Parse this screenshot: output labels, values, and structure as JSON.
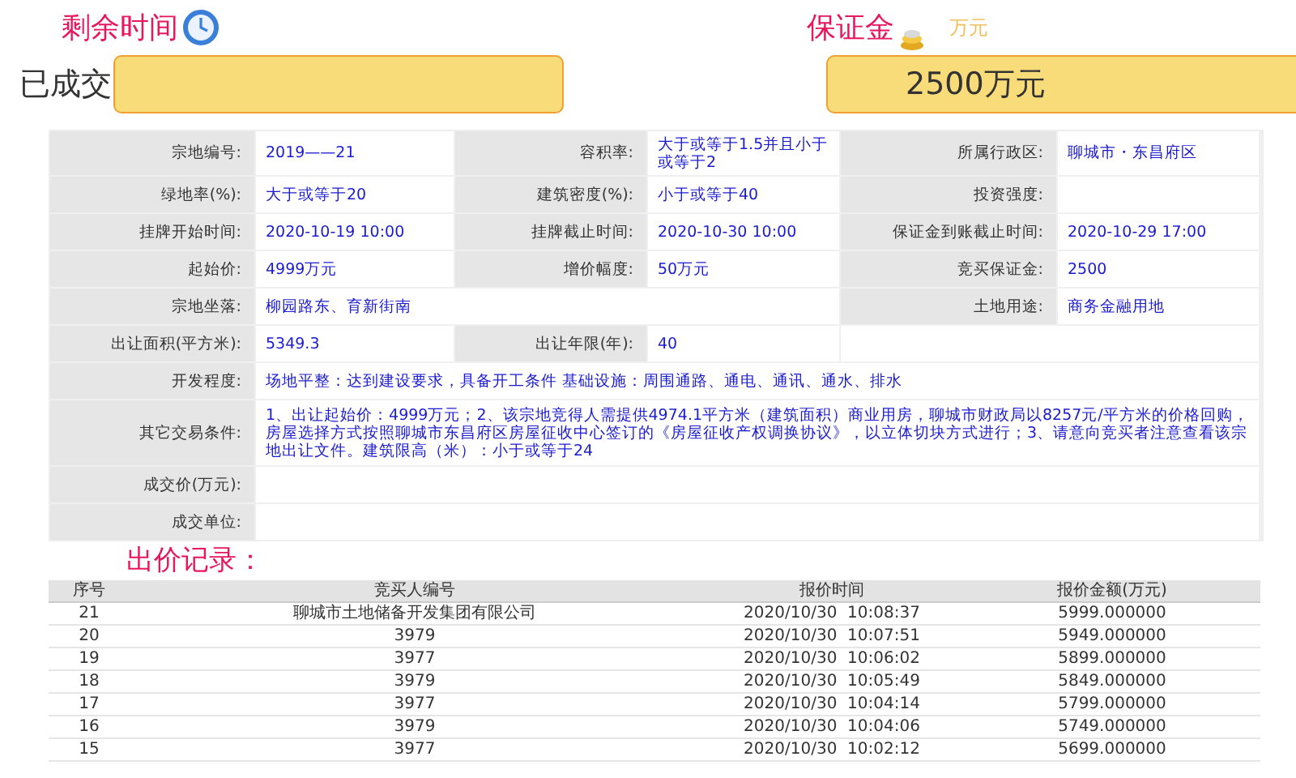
{
  "header": {
    "timer_label": "剩余时间",
    "status": "已成交",
    "deposit_label": "保证金",
    "deposit_unit": "万元",
    "deposit_value": "2500万元"
  },
  "info_rows": [
    {
      "fields": [
        {
          "kind": "pair",
          "label": "宗地编号:",
          "value": "2019——21"
        },
        {
          "kind": "pair",
          "label": "容积率:",
          "value": "大于或等于1.5并且小于或等于2"
        },
        {
          "kind": "pair",
          "label": "所属行政区:",
          "value": "聊城市・东昌府区"
        }
      ]
    },
    {
      "fields": [
        {
          "kind": "pair",
          "label": "绿地率(%):",
          "value": "大于或等于20"
        },
        {
          "kind": "pair",
          "label": "建筑密度(%):",
          "value": "小于或等于40"
        },
        {
          "kind": "pair",
          "label": "投资强度:"
        }
      ]
    },
    {
      "fields": [
        {
          "kind": "pair",
          "label": "挂牌开始时间:",
          "value": "2020-10-19 10:00"
        },
        {
          "kind": "pair",
          "label": "挂牌截止时间:",
          "value": "2020-10-30 10:00"
        },
        {
          "kind": "pair",
          "label": "保证金到账截止时间:",
          "value": "2020-10-29 17:00"
        }
      ]
    },
    {
      "fields": [
        {
          "kind": "pair",
          "label": "起始价:",
          "value": "4999万元"
        },
        {
          "kind": "pair",
          "label": "增价幅度:",
          "value": "50万元"
        },
        {
          "kind": "pair",
          "label": "竞买保证金:",
          "value": "2500"
        }
      ]
    },
    {
      "fields": [
        {
          "kind": "wide",
          "label": "宗地坐落:",
          "value": "柳园路东、育新街南"
        },
        {
          "kind": "pair",
          "label": "土地用途:",
          "value": "商务金融用地"
        }
      ]
    },
    {
      "fields": [
        {
          "kind": "pair",
          "label": "出让面积(平方米):",
          "value": "5349.3"
        },
        {
          "kind": "pair",
          "label": "出让年限(年):",
          "value": "40"
        }
      ]
    },
    {
      "fields": [
        {
          "kind": "full",
          "label": "开发程度:",
          "value": "场地平整：达到建设要求，具备开工条件 基础设施：周围通路、通电、通讯、通水、排水"
        }
      ]
    },
    {
      "fields": [
        {
          "kind": "full",
          "label": "其它交易条件:",
          "value": "1、出让起始价：4999万元；2、该宗地竞得人需提供4974.1平方米（建筑面积）商业用房，聊城市财政局以8257元/平方米的价格回购，房屋选择方式按照聊城市东昌府区房屋征收中心签订的《房屋征收产权调换协议》，以立体切块方式进行；3、请意向竞买者注意查看该宗地出让文件。建筑限高（米）：小于或等于24"
        }
      ]
    },
    {
      "fields": [
        {
          "kind": "full",
          "label": "成交价(万元):"
        }
      ]
    },
    {
      "fields": [
        {
          "kind": "full",
          "label": "成交单位:"
        }
      ]
    }
  ],
  "bids": {
    "title": "出价记录：",
    "columns": [
      "序号",
      "竞买人编号",
      "报价时间",
      "报价金额(万元)"
    ],
    "rows": [
      [
        "21",
        "聊城市土地储备开发集团有限公司",
        "2020/10/30  10:08:37",
        "5999.000000"
      ],
      [
        "20",
        "3979",
        "2020/10/30  10:07:51",
        "5949.000000"
      ],
      [
        "19",
        "3977",
        "2020/10/30  10:06:02",
        "5899.000000"
      ],
      [
        "18",
        "3979",
        "2020/10/30  10:05:49",
        "5849.000000"
      ],
      [
        "17",
        "3977",
        "2020/10/30  10:04:14",
        "5799.000000"
      ],
      [
        "16",
        "3979",
        "2020/10/30  10:04:06",
        "5749.000000"
      ],
      [
        "15",
        "3977",
        "2020/10/30  10:02:12",
        "5699.000000"
      ]
    ]
  }
}
